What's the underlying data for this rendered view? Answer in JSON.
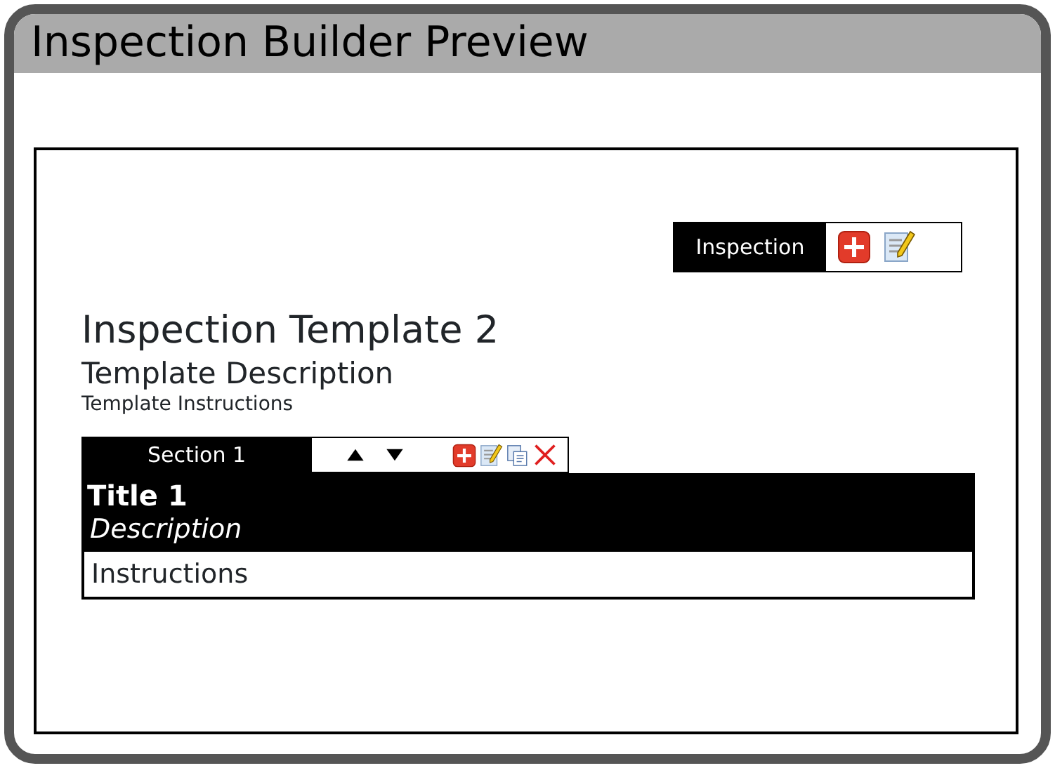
{
  "window": {
    "title": "Inspection Builder Preview"
  },
  "inspection_toolbar": {
    "label": "Inspection"
  },
  "template": {
    "title": "Inspection Template 2",
    "description": "Template Description",
    "instructions": "Template Instructions"
  },
  "sections": [
    {
      "tab": "Section 1",
      "title": "Title 1",
      "description": "Description",
      "instructions": "Instructions"
    }
  ]
}
